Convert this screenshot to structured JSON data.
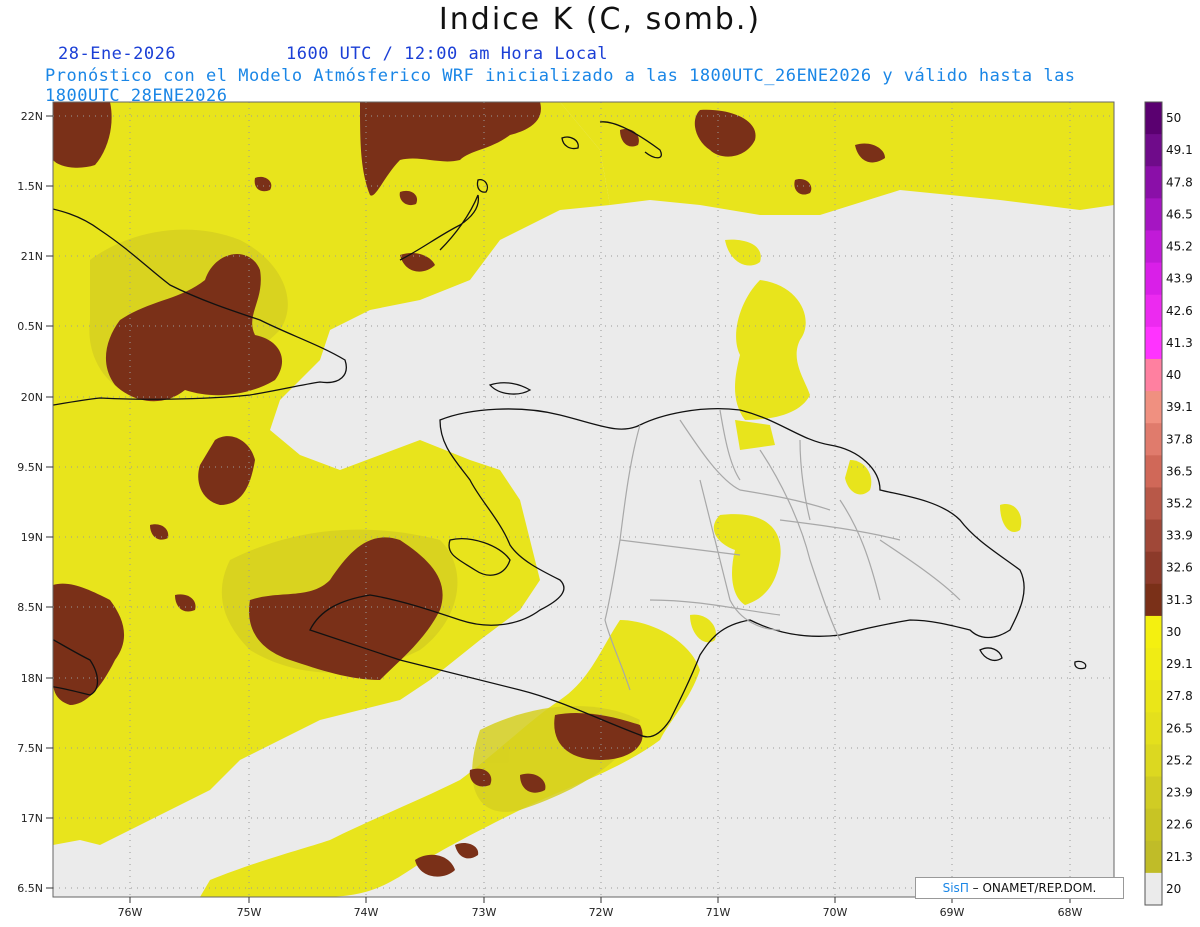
{
  "header": {
    "title": "Indice K (C, somb.)",
    "date": "28-Ene-2026",
    "time": "1600 UTC / 12:00 am Hora Local",
    "description": "Pronóstico con el Modelo Atmósferico WRF inicializado a las 1800UTC_26ENE2026 y válido hasta las  1800UTC_28ENE2026"
  },
  "map": {
    "lat_labels": [
      "22N",
      "1.5N",
      "21N",
      "0.5N",
      "20N",
      "9.5N",
      "19N",
      "8.5N",
      "18N",
      "7.5N",
      "17N",
      "6.5N"
    ],
    "lon_labels": [
      "76W",
      "75W",
      "74W",
      "73W",
      "72W",
      "71W",
      "70W",
      "69W",
      "68W"
    ],
    "background_color": "#ebebeb"
  },
  "colorbar": {
    "labels": [
      "50",
      "49.1",
      "47.8",
      "46.5",
      "45.2",
      "43.9",
      "42.6",
      "41.3",
      "40",
      "39.1",
      "37.8",
      "36.5",
      "35.2",
      "33.9",
      "32.6",
      "31.3",
      "30",
      "29.1",
      "27.8",
      "26.5",
      "25.2",
      "23.9",
      "22.6",
      "21.3",
      "20"
    ],
    "colors": [
      "#5a0070",
      "#6f0b8a",
      "#8a0fa8",
      "#a515c2",
      "#c11ad8",
      "#d91fe8",
      "#ec2af0",
      "#ff33ff",
      "#ff80a0",
      "#f09080",
      "#e07b6c",
      "#d06858",
      "#b85848",
      "#a04838",
      "#8c3a2a",
      "#7a3018",
      "#f4f010",
      "#f0ec14",
      "#eae618",
      "#e4e01c",
      "#dcd820",
      "#d0cc24",
      "#c8c424",
      "#c0bc28",
      "#ebebeb"
    ]
  },
  "credit": {
    "brand": "SisΠ",
    "text": " – ONAMET/REP.DOM."
  }
}
